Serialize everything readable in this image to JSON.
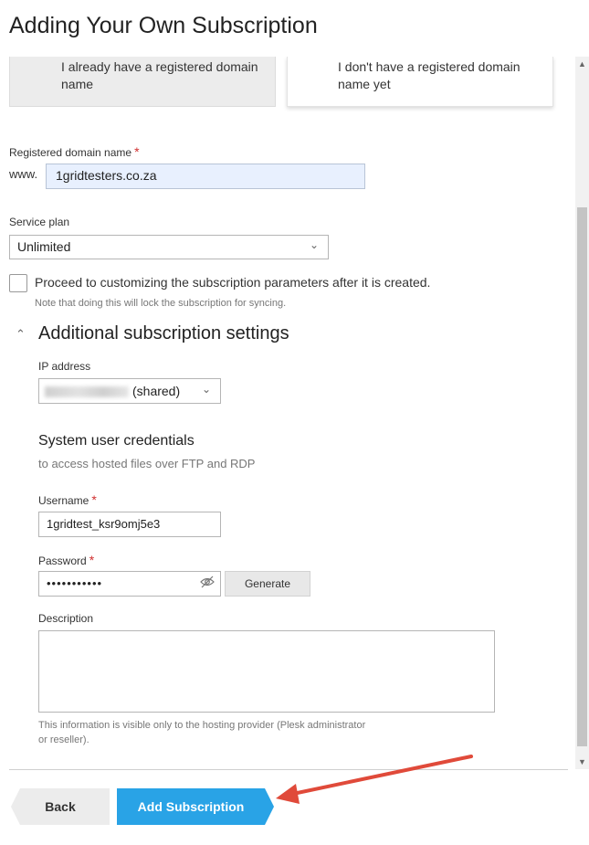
{
  "page": {
    "title": "Adding Your Own Subscription"
  },
  "domain_options": {
    "registered": "I already have a registered domain name",
    "unregistered": "I don't have a registered domain name yet"
  },
  "domain": {
    "label": "Registered domain name",
    "required_marker": "*",
    "prefix": "www.",
    "value": "1gridtesters.co.za"
  },
  "service_plan": {
    "label": "Service plan",
    "value": "Unlimited"
  },
  "customize": {
    "label": "Proceed to customizing the subscription parameters after it is created.",
    "note": "Note that doing this will lock the subscription for syncing.",
    "checked": false
  },
  "additional": {
    "title": "Additional subscription settings",
    "ip": {
      "label": "IP address",
      "suffix": "(shared)"
    },
    "credentials": {
      "title": "System user credentials",
      "subtitle": "to access hosted files over FTP and RDP",
      "username_label": "Username",
      "username_value": "1gridtest_ksr9omj5e3",
      "password_label": "Password",
      "password_mask": "•••••••••••",
      "generate_label": "Generate"
    },
    "description": {
      "label": "Description",
      "help": "This information is visible only to the hosting provider (Plesk administrator or reseller)."
    }
  },
  "footer": {
    "back_label": "Back",
    "add_label": "Add Subscription"
  },
  "colors": {
    "primary": "#29a3e6",
    "required": "#d02f2f",
    "annotation_arrow": "#e04a3a"
  }
}
